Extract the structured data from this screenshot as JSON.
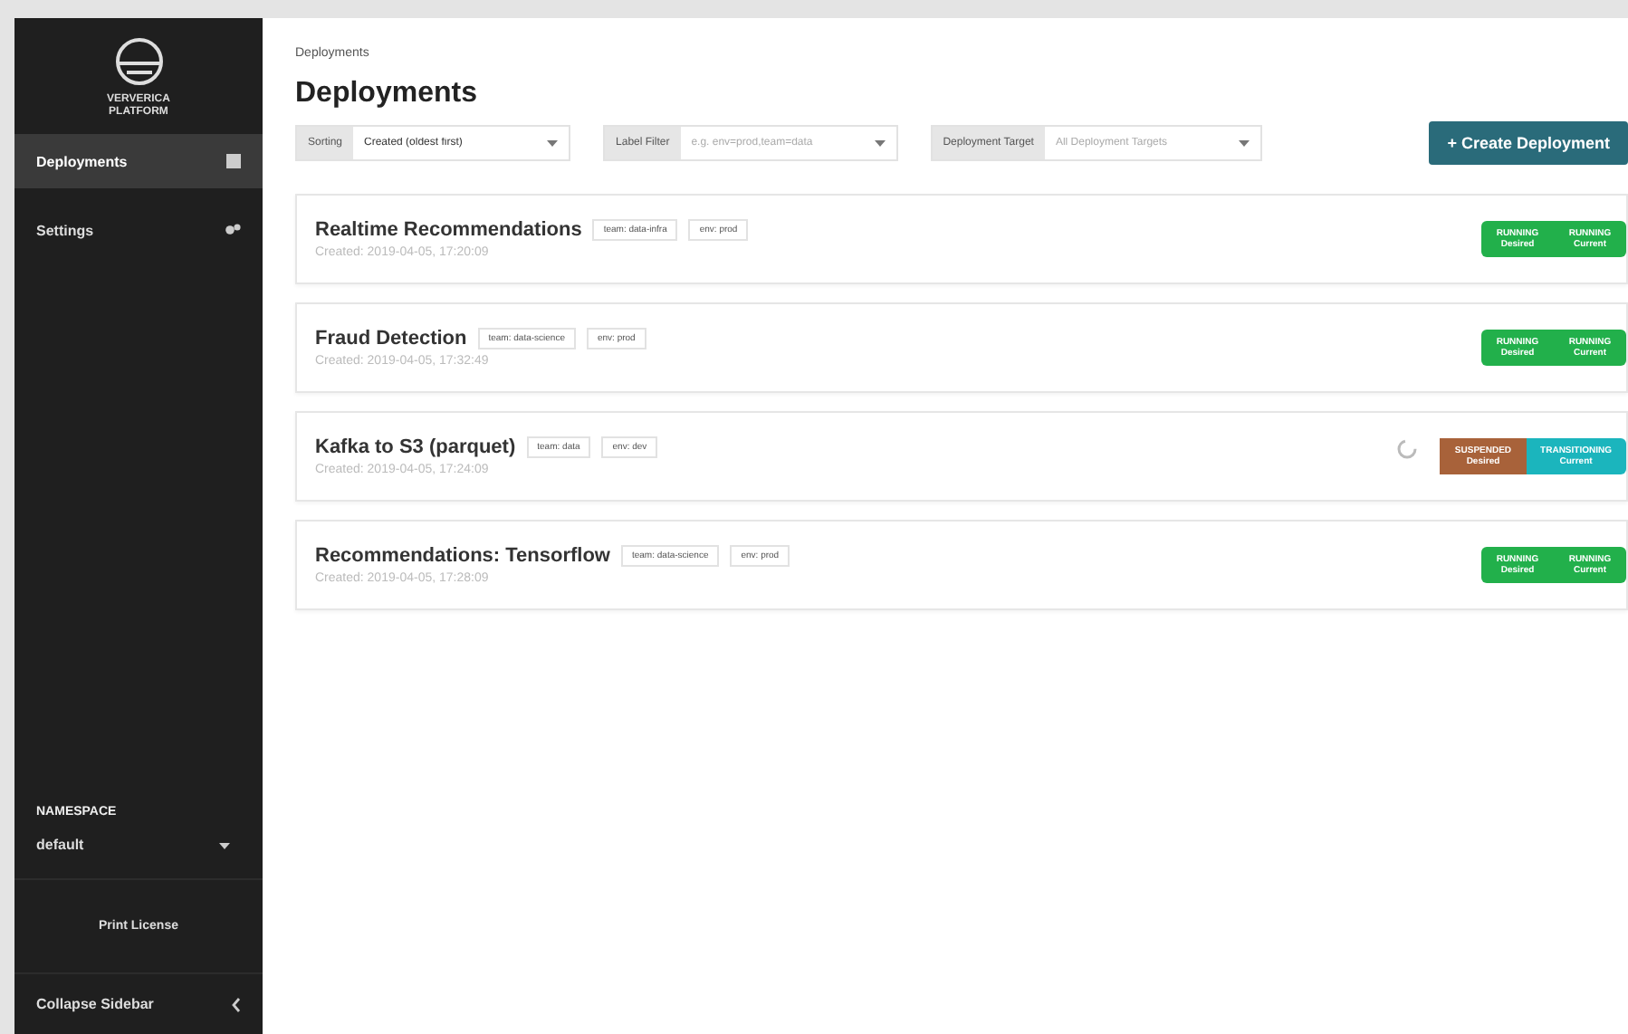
{
  "sidebar": {
    "logo_text": "VERVERICA PLATFORM",
    "items": [
      {
        "label": "Deployments",
        "selected": true,
        "kind": "grid"
      },
      {
        "label": "Settings",
        "selected": false,
        "kind": "gears"
      }
    ],
    "namespace": {
      "heading": "NAMESPACE",
      "value": "default"
    },
    "license": "Print License",
    "collapse": "Collapse Sidebar"
  },
  "breadcrumb": "Deployments",
  "title": "Deployments",
  "filters": [
    {
      "label": "Sorting",
      "value": "Created (oldest first)"
    },
    {
      "label": "Label Filter",
      "placeholder": "e.g. env=prod,team=data"
    },
    {
      "label": "Deployment Target",
      "placeholder": "All Deployment Targets"
    }
  ],
  "create_button": "+ Create Deployment",
  "deployments": [
    {
      "name": "Realtime Recommendations",
      "labels": [
        "team: data-infra",
        "env: prod"
      ],
      "created": "Created: 2019-04-05, 17:20:09",
      "busy": false,
      "status": [
        {
          "state": "RUNNING",
          "label": "Desired",
          "color": "#22b04b"
        },
        {
          "state": "RUNNING",
          "label": "Current",
          "color": "#22b04b"
        }
      ]
    },
    {
      "name": "Fraud Detection",
      "labels": [
        "team: data-science",
        "env: prod"
      ],
      "created": "Created: 2019-04-05, 17:32:49",
      "busy": false,
      "status": [
        {
          "state": "RUNNING",
          "label": "Desired",
          "color": "#22b04b"
        },
        {
          "state": "RUNNING",
          "label": "Current",
          "color": "#22b04b"
        }
      ]
    },
    {
      "name": "Kafka to S3 (parquet)",
      "labels": [
        "team: data",
        "env: dev"
      ],
      "created": "Created: 2019-04-05, 17:24:09",
      "busy": true,
      "status": [
        {
          "state": "SUSPENDED",
          "label": "Desired",
          "color": "#a8623a"
        },
        {
          "state": "TRANSITIONING",
          "label": "Current",
          "color": "#1bb5bd"
        }
      ]
    },
    {
      "name": "Recommendations: Tensorflow",
      "labels": [
        "team: data-science",
        "env: prod"
      ],
      "created": "Created: 2019-04-05, 17:28:09",
      "busy": false,
      "status": [
        {
          "state": "RUNNING",
          "label": "Desired",
          "color": "#22b04b"
        },
        {
          "state": "RUNNING",
          "label": "Current",
          "color": "#22b04b"
        }
      ]
    }
  ]
}
